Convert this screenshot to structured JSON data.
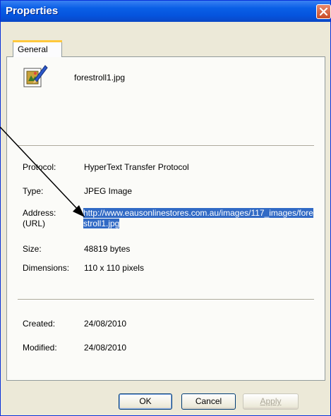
{
  "window": {
    "title": "Properties"
  },
  "tabs": [
    {
      "label": "General"
    }
  ],
  "file": {
    "name": "forestroll1.jpg"
  },
  "fields": {
    "protocol": {
      "label": "Protocol:",
      "value": "HyperText Transfer Protocol"
    },
    "type": {
      "label": "Type:",
      "value": "JPEG Image"
    },
    "address": {
      "label_line1": "Address:",
      "label_line2": "(URL)",
      "value": "http://www.eausonlinestores.com.au/images/117_images/forestroll1.jpg"
    },
    "size": {
      "label": "Size:",
      "value": "48819 bytes"
    },
    "dimensions": {
      "label": "Dimensions:",
      "value": "110 x 110 pixels"
    },
    "created": {
      "label": "Created:",
      "value": "24/08/2010"
    },
    "modified": {
      "label": "Modified:",
      "value": "24/08/2010"
    }
  },
  "buttons": {
    "ok": "OK",
    "cancel": "Cancel",
    "apply": "Apply"
  },
  "icons": {
    "file": "image-file-icon",
    "close": "close-icon",
    "annotation": "annotation-arrow"
  },
  "colors": {
    "titlebar": "#0554de",
    "selection": "#316ac5",
    "close": "#c94b25"
  }
}
